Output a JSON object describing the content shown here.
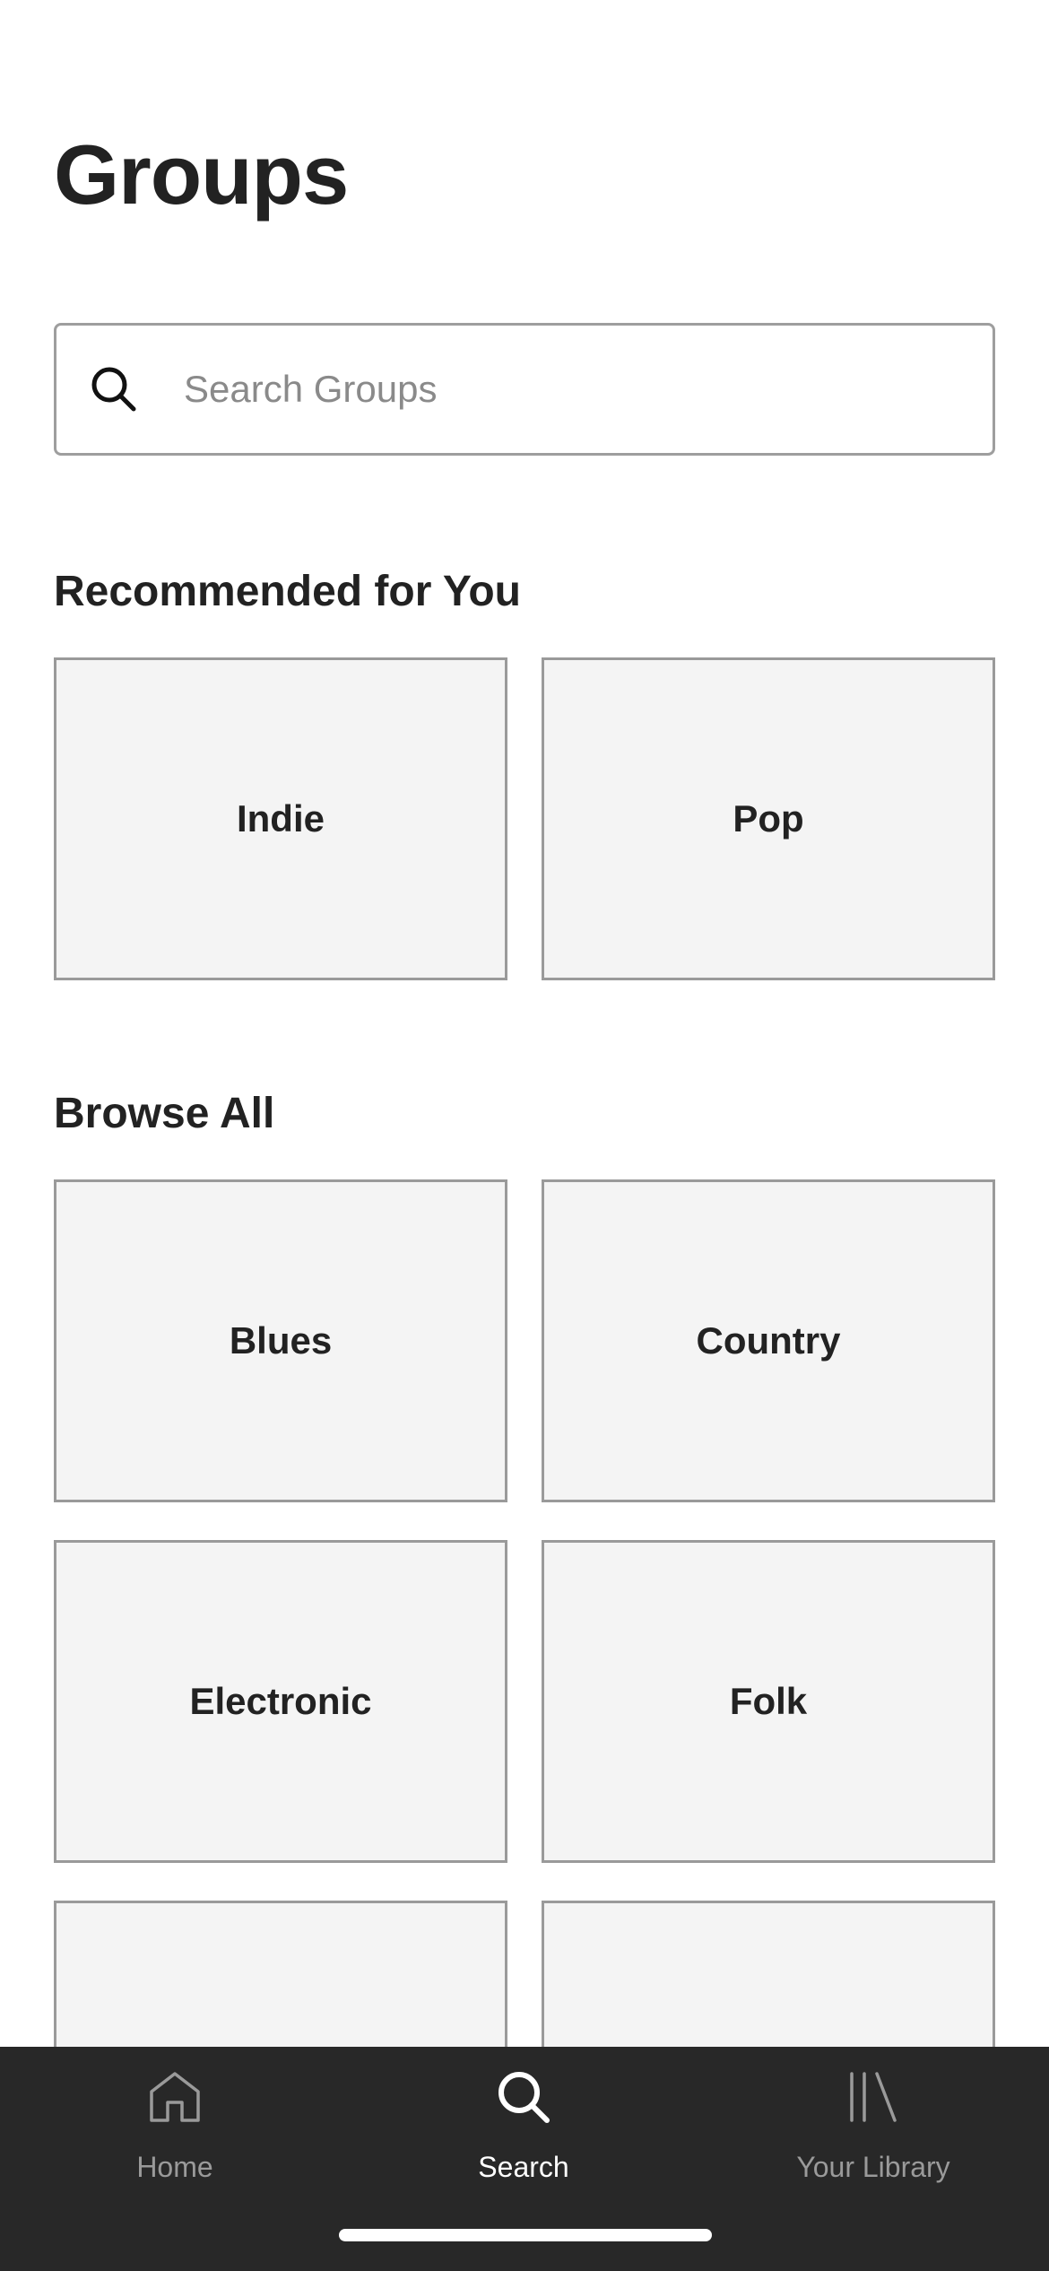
{
  "header": {
    "title": "Groups"
  },
  "search": {
    "placeholder": "Search Groups",
    "value": ""
  },
  "recommended": {
    "title": "Recommended for You",
    "items": [
      {
        "label": "Indie"
      },
      {
        "label": "Pop"
      }
    ]
  },
  "browse": {
    "title": "Browse All",
    "items": [
      {
        "label": "Blues"
      },
      {
        "label": "Country"
      },
      {
        "label": "Electronic"
      },
      {
        "label": "Folk"
      },
      {
        "label": ""
      },
      {
        "label": ""
      }
    ]
  },
  "tabbar": {
    "active": "search",
    "items": [
      {
        "id": "home",
        "label": "Home",
        "icon": "home-icon"
      },
      {
        "id": "search",
        "label": "Search",
        "icon": "search-icon"
      },
      {
        "id": "library",
        "label": "Your Library",
        "icon": "library-icon"
      }
    ]
  },
  "colors": {
    "background": "#ffffff",
    "text": "#222222",
    "tile_background": "#f4f4f4",
    "tile_border": "#9a9a9a",
    "tabbar_background": "#282828",
    "tab_inactive": "#9a9a9a",
    "tab_active": "#ffffff"
  }
}
